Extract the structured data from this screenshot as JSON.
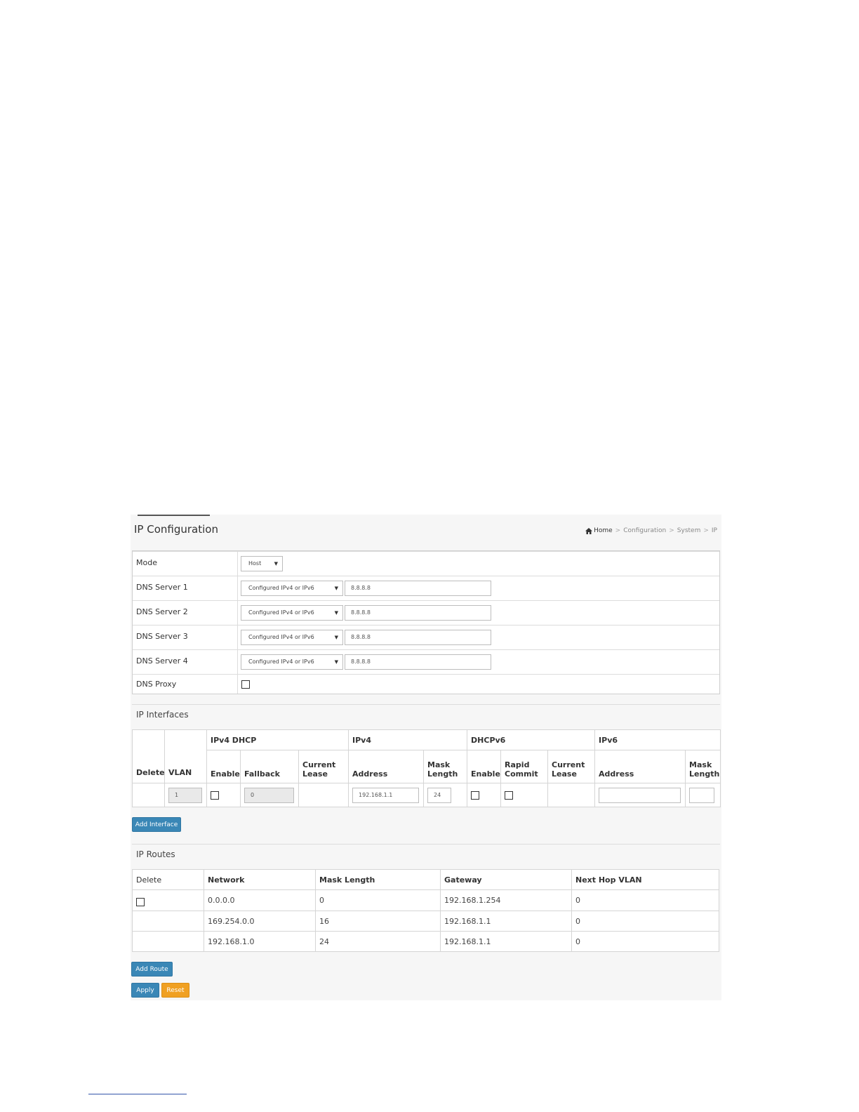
{
  "header": {
    "title": "IP Configuration",
    "breadcrumb": [
      "Home",
      "Configuration",
      "System",
      "IP"
    ],
    "breadcrumb_sep": ">"
  },
  "config": {
    "mode_label": "Mode",
    "mode_value": "Host",
    "dns_servers": [
      {
        "label": "DNS Server 1",
        "type": "Configured IPv4 or IPv6",
        "value": "8.8.8.8"
      },
      {
        "label": "DNS Server 2",
        "type": "Configured IPv4 or IPv6",
        "value": "8.8.8.8"
      },
      {
        "label": "DNS Server 3",
        "type": "Configured IPv4 or IPv6",
        "value": "8.8.8.8"
      },
      {
        "label": "DNS Server 4",
        "type": "Configured IPv4 or IPv6",
        "value": "8.8.8.8"
      }
    ],
    "dns_proxy_label": "DNS Proxy"
  },
  "interfaces": {
    "title": "IP Interfaces",
    "headers": {
      "delete": "Delete",
      "vlan": "VLAN",
      "ipv4_dhcp": "IPv4 DHCP",
      "ipv4": "IPv4",
      "dhcpv6": "DHCPv6",
      "ipv6": "IPv6",
      "enable": "Enable",
      "fallback": "Fallback",
      "current_lease": "Current Lease",
      "address": "Address",
      "mask_length": "Mask Length",
      "rapid_commit": "Rapid Commit"
    },
    "row": {
      "vlan": "1",
      "fallback": "0",
      "ipv4_address": "192.168.1.1",
      "ipv4_mask": "24",
      "ipv6_address": "",
      "ipv6_mask": ""
    },
    "add_button": "Add Interface"
  },
  "routes": {
    "title": "IP Routes",
    "headers": [
      "Delete",
      "Network",
      "Mask Length",
      "Gateway",
      "Next Hop VLAN"
    ],
    "rows": [
      {
        "network": "0.0.0.0",
        "mask": "0",
        "gateway": "192.168.1.254",
        "vlan": "0"
      },
      {
        "network": "169.254.0.0",
        "mask": "16",
        "gateway": "192.168.1.1",
        "vlan": "0"
      },
      {
        "network": "192.168.1.0",
        "mask": "24",
        "gateway": "192.168.1.1",
        "vlan": "0"
      }
    ],
    "add_button": "Add Route"
  },
  "actions": {
    "apply": "Apply",
    "reset": "Reset"
  }
}
